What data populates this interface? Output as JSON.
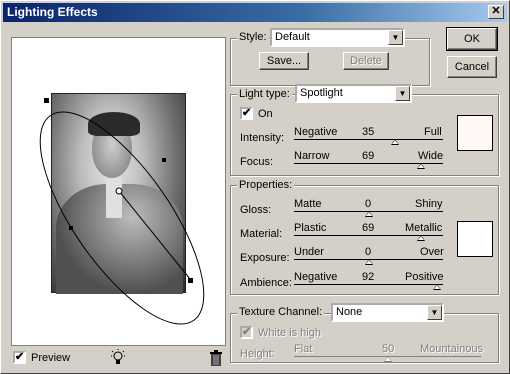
{
  "window": {
    "title": "Lighting Effects",
    "close_glyph": "✕"
  },
  "buttons": {
    "ok": "OK",
    "cancel": "Cancel",
    "save": "Save...",
    "delete": "Delete"
  },
  "style": {
    "label": "Style:",
    "value": "Default"
  },
  "light": {
    "group_label": "Light type:",
    "type_value": "Spotlight",
    "on_label": "On",
    "on_checked": true,
    "intensity": {
      "label": "Intensity:",
      "min": "Negative",
      "value": "35",
      "max": "Full",
      "level": 0.68
    },
    "focus": {
      "label": "Focus:",
      "min": "Narrow",
      "value": "69",
      "max": "Wide",
      "level": 0.85
    },
    "color": "#fff8f5"
  },
  "properties": {
    "group_label": "Properties:",
    "gloss": {
      "label": "Gloss:",
      "min": "Matte",
      "value": "0",
      "max": "Shiny",
      "level": 0.5
    },
    "material": {
      "label": "Material:",
      "min": "Plastic",
      "value": "69",
      "max": "Metallic",
      "level": 0.85
    },
    "exposure": {
      "label": "Exposure:",
      "min": "Under",
      "value": "0",
      "max": "Over",
      "level": 0.5
    },
    "ambience": {
      "label": "Ambience:",
      "min": "Negative",
      "value": "92",
      "max": "Positive",
      "level": 0.96
    },
    "color": "#ffffff"
  },
  "texture": {
    "label": "Texture Channel:",
    "value": "None",
    "white_is_high_label": "White is high",
    "height": {
      "label": "Height:",
      "min": "Flat",
      "value": "50",
      "max": "Mountainous",
      "level": 0.5
    }
  },
  "preview": {
    "label": "Preview",
    "checked": true
  },
  "icons": {
    "bulb": "lightbulb-icon",
    "trash": "trash-icon"
  }
}
